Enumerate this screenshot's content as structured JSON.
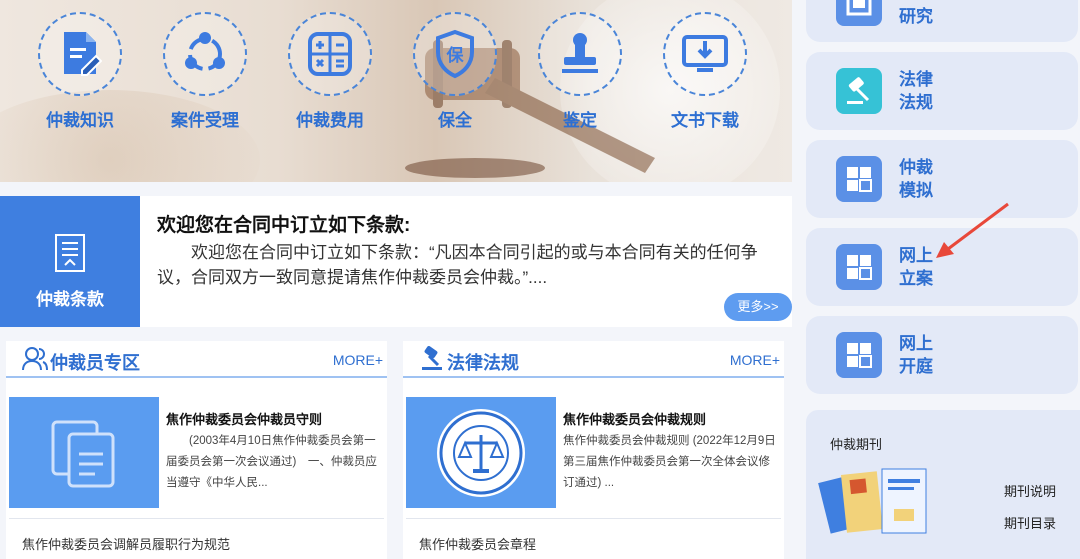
{
  "services": [
    {
      "label": "仲裁知识",
      "icon": "document-edit-icon"
    },
    {
      "label": "案件受理",
      "icon": "network-nodes-icon"
    },
    {
      "label": "仲裁费用",
      "icon": "calculator-icon"
    },
    {
      "label": "保全",
      "icon": "shield-protect-icon"
    },
    {
      "label": "鉴定",
      "icon": "stamp-icon"
    },
    {
      "label": "文书下载",
      "icon": "download-monitor-icon"
    }
  ],
  "clause": {
    "badge_label": "仲裁条款",
    "title": "欢迎您在合同中订立如下条款:",
    "body": "欢迎您在合同中订立如下条款：“凡因本合同引起的或与本合同有关的任何争议，合同双方一致同意提请焦作仲裁委员会仲裁。”....",
    "more_label": "更多>>"
  },
  "panel_arbitrators": {
    "title": "仲裁员专区",
    "more": "MORE+",
    "article_title": "焦作仲裁委员会仲裁员守则",
    "article_body": "(2003年4月10日焦作仲裁委员会第一届委员会第一次会议通过)　一、仲裁员应当遵守《中华人民...",
    "link": "焦作仲裁委员会调解员履职行为规范"
  },
  "panel_laws": {
    "title": "法律法规",
    "more": "MORE+",
    "article_title": "焦作仲裁委员会仲裁规则",
    "article_body": "焦作仲裁委员会仲裁规则 (2022年12月9日第三届焦作仲裁委员会第一次全体会议修订通过) ...",
    "link": "焦作仲裁委员会章程"
  },
  "sidebar": {
    "items": [
      {
        "label": "专题研究",
        "visible_label": "研究",
        "icon": "document-grid-icon"
      },
      {
        "label": "法律法规",
        "icon": "gavel-icon"
      },
      {
        "label": "仲裁模拟",
        "icon": "grid-icon"
      },
      {
        "label": "网上立案",
        "icon": "grid-icon"
      },
      {
        "label": "网上开庭",
        "icon": "grid-icon"
      }
    ],
    "journal": {
      "title": "仲裁期刊",
      "links": [
        "期刊说明",
        "期刊目录"
      ]
    }
  },
  "colors": {
    "primary": "#2f6fd0",
    "accent_blue": "#3f7fe0",
    "sidebar_bg": "#e3e9f7",
    "arrow": "#e8483a"
  }
}
